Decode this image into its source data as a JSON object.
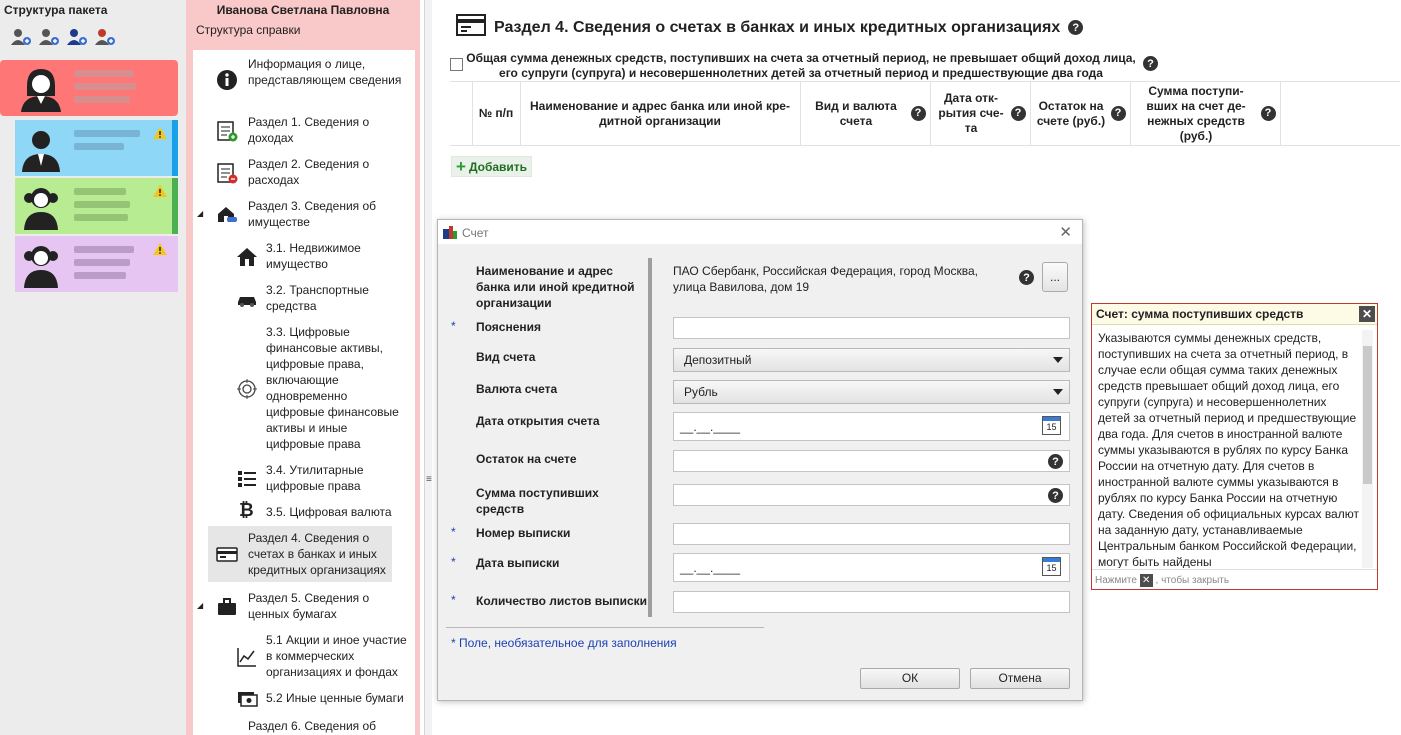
{
  "package": {
    "title": "Структура пакета",
    "tools": [
      "add-person-icon",
      "add-person-icon",
      "add-person-icon",
      "add-person-icon"
    ],
    "persons": [
      {
        "color": "#ff7676",
        "strip": "#e74c3c",
        "warning": false
      },
      {
        "color": "#8fd7f7",
        "strip": "#1aa0e8",
        "warning": true
      },
      {
        "color": "#b7ec92",
        "strip": "#4caf50",
        "warning": true
      },
      {
        "color": "#e7c5f2",
        "strip": "#d8b5ec",
        "warning": true
      }
    ]
  },
  "structure": {
    "person_name": "Иванова Светлана Павловна",
    "subtitle": "Структура справки",
    "items": [
      {
        "label": "Информация о лице, представляющем сведения"
      },
      {
        "label": "Раздел 1. Сведения о доходах"
      },
      {
        "label": "Раздел 2. Сведения о расходах"
      },
      {
        "label": "Раздел 3. Сведения об имуществе"
      },
      {
        "label": "3.1. Недвижимое имущество"
      },
      {
        "label": "3.2. Транспортные средства"
      },
      {
        "label": "3.3. Цифровые финансовые активы, цифровые права, включающие одновременно цифровые финансовые активы и иные цифровые права"
      },
      {
        "label": "3.4. Утилитарные цифровые права"
      },
      {
        "label": "3.5. Цифровая валюта"
      },
      {
        "label": "Раздел 4. Сведения о счетах в банках и иных кредитных организациях"
      },
      {
        "label": "Раздел 5. Сведения о ценных бумагах"
      },
      {
        "label": "5.1 Акции и иное участие в коммерческих организациях и фондах"
      },
      {
        "label": "5.2 Иные ценные бумаги"
      },
      {
        "label": "Раздел 6. Сведения об"
      }
    ]
  },
  "main": {
    "title": "Раздел 4. Сведения о счетах в банках и иных кредитных организациях",
    "checkbox_label": "Общая сумма денежных средств, поступивших на счета за отчетный период, не превышает общий доход лица, его супруги (супруга) и несовершеннолетних детей за отчетный период и предшествующие два года",
    "columns": [
      "№ п/п",
      "Наименование и адрес банка или иной кре-дитной организации",
      "Вид и валюта счета",
      "Дата отк-рытия сче-та",
      "Остаток на счете (руб.)",
      "Сумма поступи-вших на счет де-нежных средств (руб.)"
    ],
    "add_label": "Добавить"
  },
  "dialog": {
    "title": "Счет",
    "fields": {
      "bank_label": "Наименование и адрес банка или иной кредитной организации",
      "bank_value": "ПАО Сбербанк, Российская Федерация, город Москва, улица Вавилова, дом 19",
      "notes_label": "Пояснения",
      "type_label": "Вид счета",
      "type_value": "Депозитный",
      "currency_label": "Валюта счета",
      "currency_value": "Рубль",
      "open_date_label": "Дата открытия счета",
      "open_date_value": "__.__.____",
      "balance_label": "Остаток на счете",
      "income_label": "Сумма поступивших средств",
      "statement_no_label": "Номер выписки",
      "statement_date_label": "Дата выписки",
      "statement_date_value": "__.__.____",
      "sheets_label": "Количество листов выписки"
    },
    "star": "*",
    "optional_note": "*   Поле, необязательное для заполнения",
    "ok_label": "ОК",
    "cancel_label": "Отмена",
    "calendar_day": "15",
    "browse_label": "..."
  },
  "help": {
    "title": "Счет:  сумма поступивших средств",
    "body": "Указываются суммы денежных средств, поступивших на счета за отчетный период, в случае если общая сумма таких денежных средств превышает общий доход лица, его супруги (супруга) и несовершеннолетних детей за отчетный период и предшествующие два года. Для счетов в иностранной валюте суммы указываются в рублях по курсу Банка России на отчетную дату. Для счетов в иностранной валюте суммы указываются в рублях по курсу Банка России на отчетную дату. Сведения об официальных курсах валют на заданную дату, устанавливаемые Центральным банком Российской Федерации, могут быть найдены",
    "footer_before": "Нажмите",
    "footer_after": ", чтобы закрыть"
  }
}
